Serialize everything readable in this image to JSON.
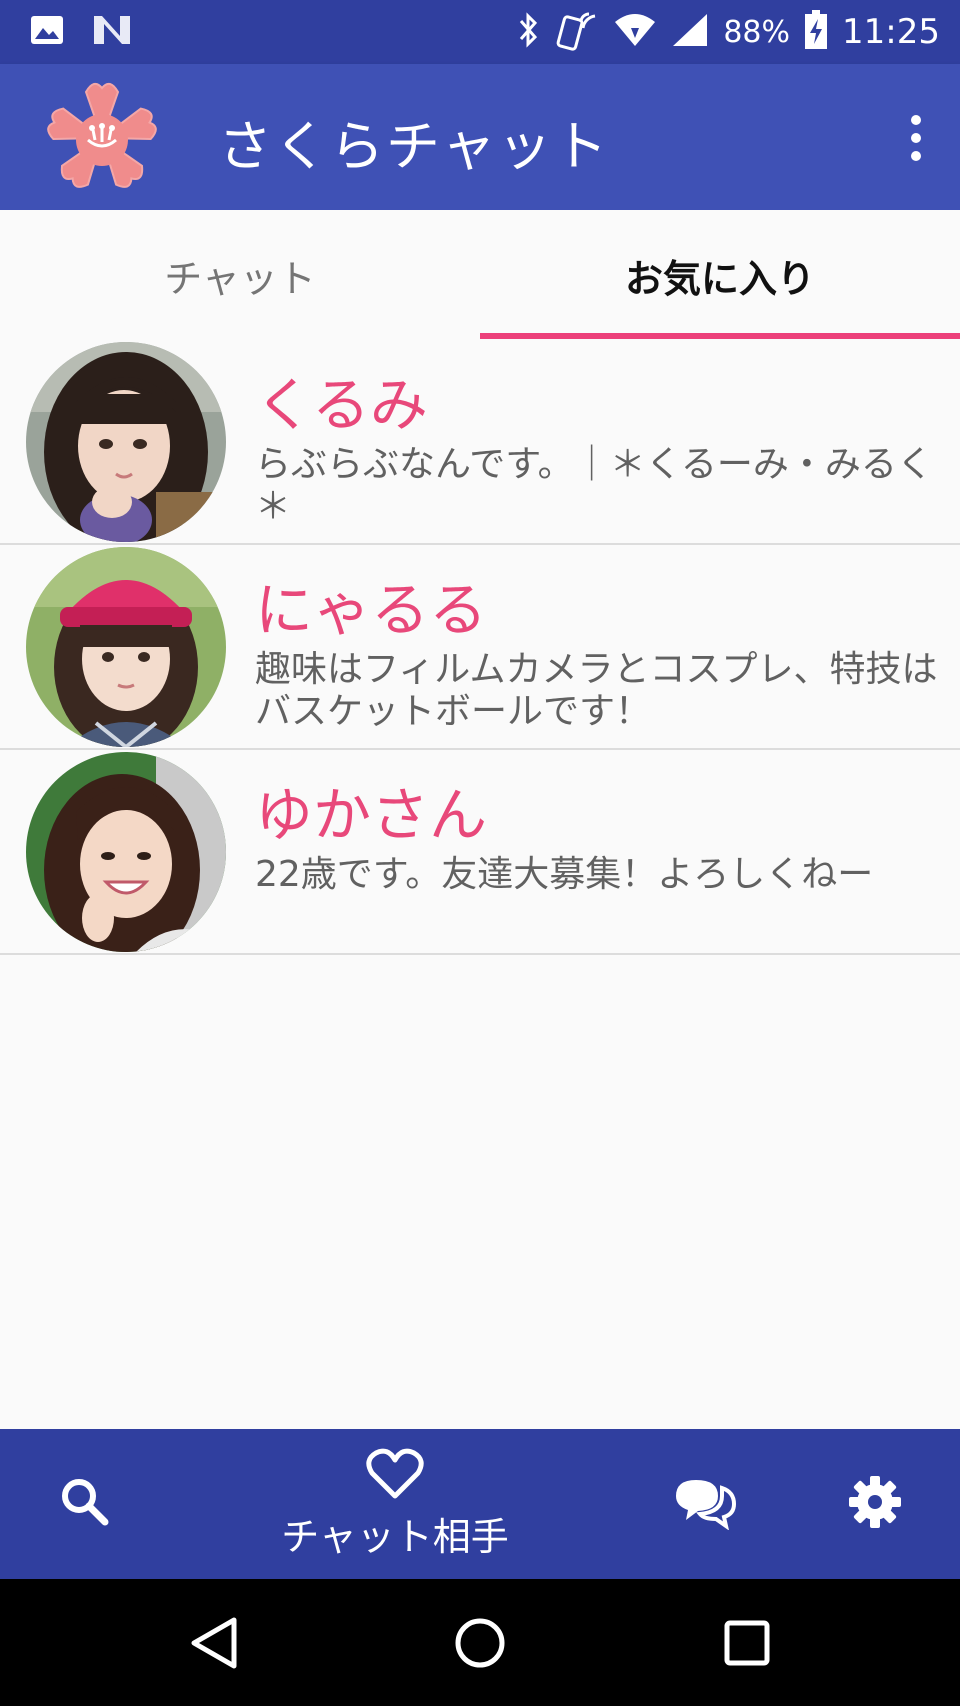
{
  "status_bar": {
    "battery": "88%",
    "time": "11:25",
    "icons": [
      "image-icon",
      "n-icon",
      "bluetooth-icon",
      "nfc-icon",
      "wifi-icon",
      "signal-icon",
      "battery-charging-icon"
    ]
  },
  "app_bar": {
    "title": "さくらチャット",
    "logo": "sakura-logo-icon",
    "menu_icon": "more-vert-icon"
  },
  "tabs": {
    "items": [
      {
        "label": "チャット",
        "selected": false
      },
      {
        "label": "お気に入り",
        "selected": true
      }
    ]
  },
  "favorites": [
    {
      "name": "くるみ",
      "message": "らぶらぶなんです。｜＊くるーみ・みるく＊",
      "avatar": "avatar-photo"
    },
    {
      "name": "にゃるる",
      "message": "趣味はフィルムカメラとコスプレ、特技はバスケットボールです！",
      "avatar": "avatar-photo"
    },
    {
      "name": "ゆかさん",
      "message": "22歳です。友達大募集！よろしくねー",
      "avatar": "avatar-photo"
    }
  ],
  "bottom_nav": {
    "search_icon": "search-icon",
    "partners_icon": "heart-icon",
    "partners_label": "チャット相手",
    "messages_icon": "chat-bubbles-icon",
    "settings_icon": "gear-icon"
  },
  "system_nav": [
    "back-icon",
    "home-icon",
    "recents-icon"
  ],
  "colors": {
    "primary_dark": "#303f9f",
    "primary": "#3f51b5",
    "accent": "#ec407a",
    "name_color": "#e8487a"
  }
}
